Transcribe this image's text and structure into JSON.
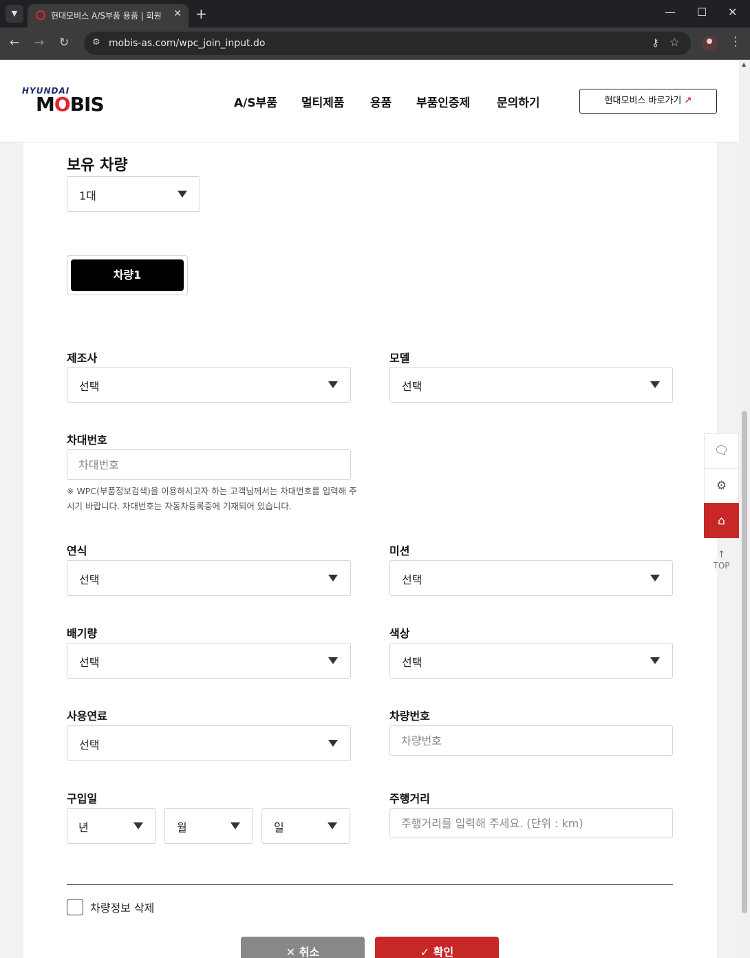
{
  "browser": {
    "tab_title": "현대모비스 A/S부품 용품 | 회원",
    "url": "mobis-as.com/wpc_join_input.do",
    "new_tab": "+",
    "close_tab": "✕"
  },
  "header": {
    "logo_top": "HYUNDAI",
    "logo_main_prefix": "M",
    "logo_main_o": "O",
    "logo_main_suffix": "BIS",
    "nav": [
      "A/S부품",
      "멀티제품",
      "용품",
      "부품인증제",
      "문의하기"
    ],
    "shortcut_label": "현대모비스 바로가기",
    "shortcut_arrow": "↗"
  },
  "form": {
    "owned_title": "보유 차량",
    "owned_count": "1대",
    "vehicle_tab": "차량1",
    "manufacturer": {
      "label": "제조사",
      "value": "선택"
    },
    "model": {
      "label": "모델",
      "value": "선택"
    },
    "vin": {
      "label": "차대번호",
      "placeholder": "차대번호"
    },
    "vin_notice": "※ WPC(부품정보검색)을 이용하시고자 하는 고객님께서는 차대번호를 입력해 주시기 바랍니다. 차대번호는 자동차등록증에 기재되어 있습니다.",
    "year": {
      "label": "연식",
      "value": "선택"
    },
    "transmission": {
      "label": "미션",
      "value": "선택"
    },
    "displacement": {
      "label": "배기량",
      "value": "선택"
    },
    "color": {
      "label": "색상",
      "value": "선택"
    },
    "fuel": {
      "label": "사용연료",
      "value": "선택"
    },
    "plate": {
      "label": "차량번호",
      "placeholder": "차량번호"
    },
    "purchase": {
      "label": "구입일",
      "year": "년",
      "month": "월",
      "day": "일"
    },
    "mileage": {
      "label": "주행거리",
      "placeholder": "주행거리를 입력해 주세요. (단위 : km)"
    },
    "delete_label": "차량정보 삭제",
    "cancel": "✕ 취소",
    "confirm": "✓ 확인"
  },
  "quick_menu": {
    "top": "TOP"
  }
}
